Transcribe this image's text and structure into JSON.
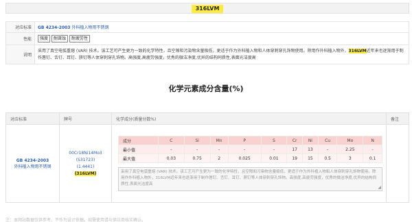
{
  "title": "316LVM",
  "info": {
    "standard_label": "对应标准",
    "standard_code": "GB 4234-2003",
    "standard_name": "外科植入物用不锈钢",
    "properties_label": "性能",
    "tags": [
      "强度",
      "耐腐蚀",
      "耐疲劳性"
    ],
    "desc_label": "说明",
    "desc_part1": "采用了真空电弧重熔 (VAR) 技术。该工艺可产生更为一致的化学特性，且空隙和污染物含量极低，更适于作为外科植入物和人体穿刺穿孔饰物使用。除用作外科植入物外，",
    "desc_highlight": "316LVM",
    "desc_part2": "近年来也逐渐用于制作唇钉、舌钉、耳钉、脐钉等人体穿刺穿孔饰物。高强度,高疲劳强度，优秀的微洁净度,优异的结构同质性,表面光洁度高"
  },
  "section_title": "化学元素成分含量(%)",
  "table": {
    "headers": [
      "对应标准",
      "牌号",
      "化学成分(质量分数%)",
      "备注"
    ],
    "std_code": "GB 4234-2003",
    "std_name": "外科植入物用不锈钢",
    "grade_lines": [
      "00Cr18Ni14Mo3",
      "(S31723)",
      "(1.4441)"
    ],
    "grade_highlight": "(316LVM)",
    "note": ""
  },
  "composition": {
    "header_label": "成分",
    "elements": [
      "C",
      "Si",
      "Mn",
      "P",
      "S",
      "Cr",
      "Ni",
      "Cu",
      "Mo",
      "N"
    ],
    "rows": [
      {
        "label": "最小值",
        "values": [
          "-",
          "-",
          "-",
          "-",
          "-",
          "17",
          "13",
          "-",
          "2.25",
          "-"
        ]
      },
      {
        "label": "最大值",
        "values": [
          "0.03",
          "0.75",
          "2",
          "0.025",
          "0.01",
          "19",
          "15",
          "0.5",
          "3",
          "0.1"
        ]
      }
    ]
  },
  "textarea_text": "采用了真空电弧重熔 (VAR) 技术。该工艺可产生更为一致的化学特性，且空隙和污染物含量极低，更适于作为外科植入物和人体穿刺穿孔饰物使用。除用作外科植入物外，316LVM近年来也逐渐用于制作唇钉、舌钉、耳钉、脐钉等人体穿刺穿孔饰物。高强度,高疲劳强度，优秀的微洁净度,优异的结构同质性,表面光洁度高",
  "footer": "注：本网站数据仅供参考，不作为设计依据。如需使用请与供应商核实确认。"
}
